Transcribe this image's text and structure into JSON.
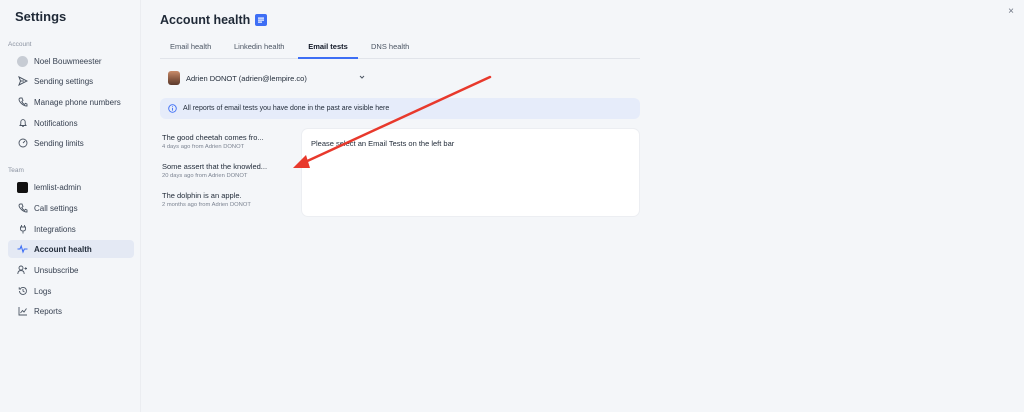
{
  "sidebar": {
    "title": "Settings",
    "account_section": "Account",
    "team_section": "Team",
    "account_items": [
      {
        "label": "Noel Bouwmeester",
        "icon": "avatar"
      },
      {
        "label": "Sending settings",
        "icon": "send-icon"
      },
      {
        "label": "Manage phone numbers",
        "icon": "phone-icon"
      },
      {
        "label": "Notifications",
        "icon": "bell-icon"
      },
      {
        "label": "Sending limits",
        "icon": "gauge-icon"
      }
    ],
    "team_items": [
      {
        "label": "lemlist-admin",
        "icon": "lemlist-logo"
      },
      {
        "label": "Call settings",
        "icon": "phone-icon"
      },
      {
        "label": "Integrations",
        "icon": "plug-icon"
      },
      {
        "label": "Account health",
        "icon": "pulse-icon",
        "active": true
      },
      {
        "label": "Unsubscribe",
        "icon": "user-remove-icon"
      },
      {
        "label": "Logs",
        "icon": "history-icon"
      },
      {
        "label": "Reports",
        "icon": "chart-icon"
      }
    ]
  },
  "header": {
    "title": "Account health",
    "close_label": "×"
  },
  "tabs": [
    {
      "label": "Email health",
      "active": false
    },
    {
      "label": "Linkedin health",
      "active": false
    },
    {
      "label": "Email tests",
      "active": true
    },
    {
      "label": "DNS health",
      "active": false
    }
  ],
  "user_select": {
    "value": "Adrien DONOT (adrien@lempire.co)"
  },
  "info_banner": {
    "text": "All reports of email tests you have done in the past are visible here"
  },
  "tests": [
    {
      "title": "The good cheetah comes fro...",
      "meta": "4 days ago from Adrien DONOT"
    },
    {
      "title": "Some assert that the knowled...",
      "meta": "20 days ago from Adrien DONOT"
    },
    {
      "title": "The dolphin is an apple.",
      "meta": "2 months ago from Adrien DONOT"
    }
  ],
  "detail": {
    "placeholder_text": "Please select an Email Tests on the left bar"
  },
  "colors": {
    "accent": "#3d6ef5",
    "annotation_arrow": "#e8392c"
  }
}
